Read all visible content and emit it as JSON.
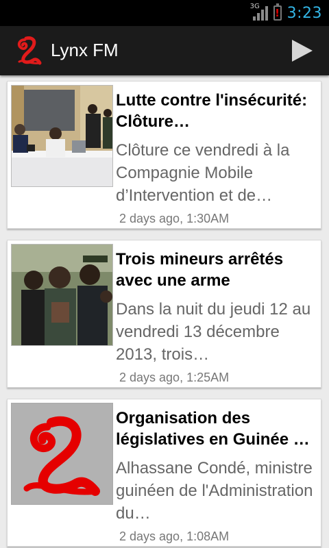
{
  "status_bar": {
    "network": "3G",
    "time": "3:23",
    "icons": [
      "signal-icon",
      "battery-warning-icon"
    ]
  },
  "app": {
    "title": "Lynx FM",
    "logo_icon": "lynx-logo-icon",
    "action_icon": "play-icon",
    "accent_color": "#e11b1b"
  },
  "articles": [
    {
      "title": "Lutte contre l'insécurité: Clôture…",
      "summary": "Clôture ce vendredi à la Compagnie Mobile d’Intervention et de…",
      "time": "2 days ago, 1:30AM",
      "thumbnail": "press-conference-photo"
    },
    {
      "title": "Trois mineurs arrêtés avec une arme",
      "summary": "Dans la nuit du jeudi 12 au vendredi 13 décembre 2013, trois…",
      "time": "2 days ago, 1:25AM",
      "thumbnail": "crowd-photo"
    },
    {
      "title": "Organisation des législatives en Guinée …",
      "summary": "Alhassane Condé, ministre guinéen de l'Administration du…",
      "time": "2 days ago, 1:08AM",
      "thumbnail": "lynx-logo-placeholder"
    }
  ]
}
